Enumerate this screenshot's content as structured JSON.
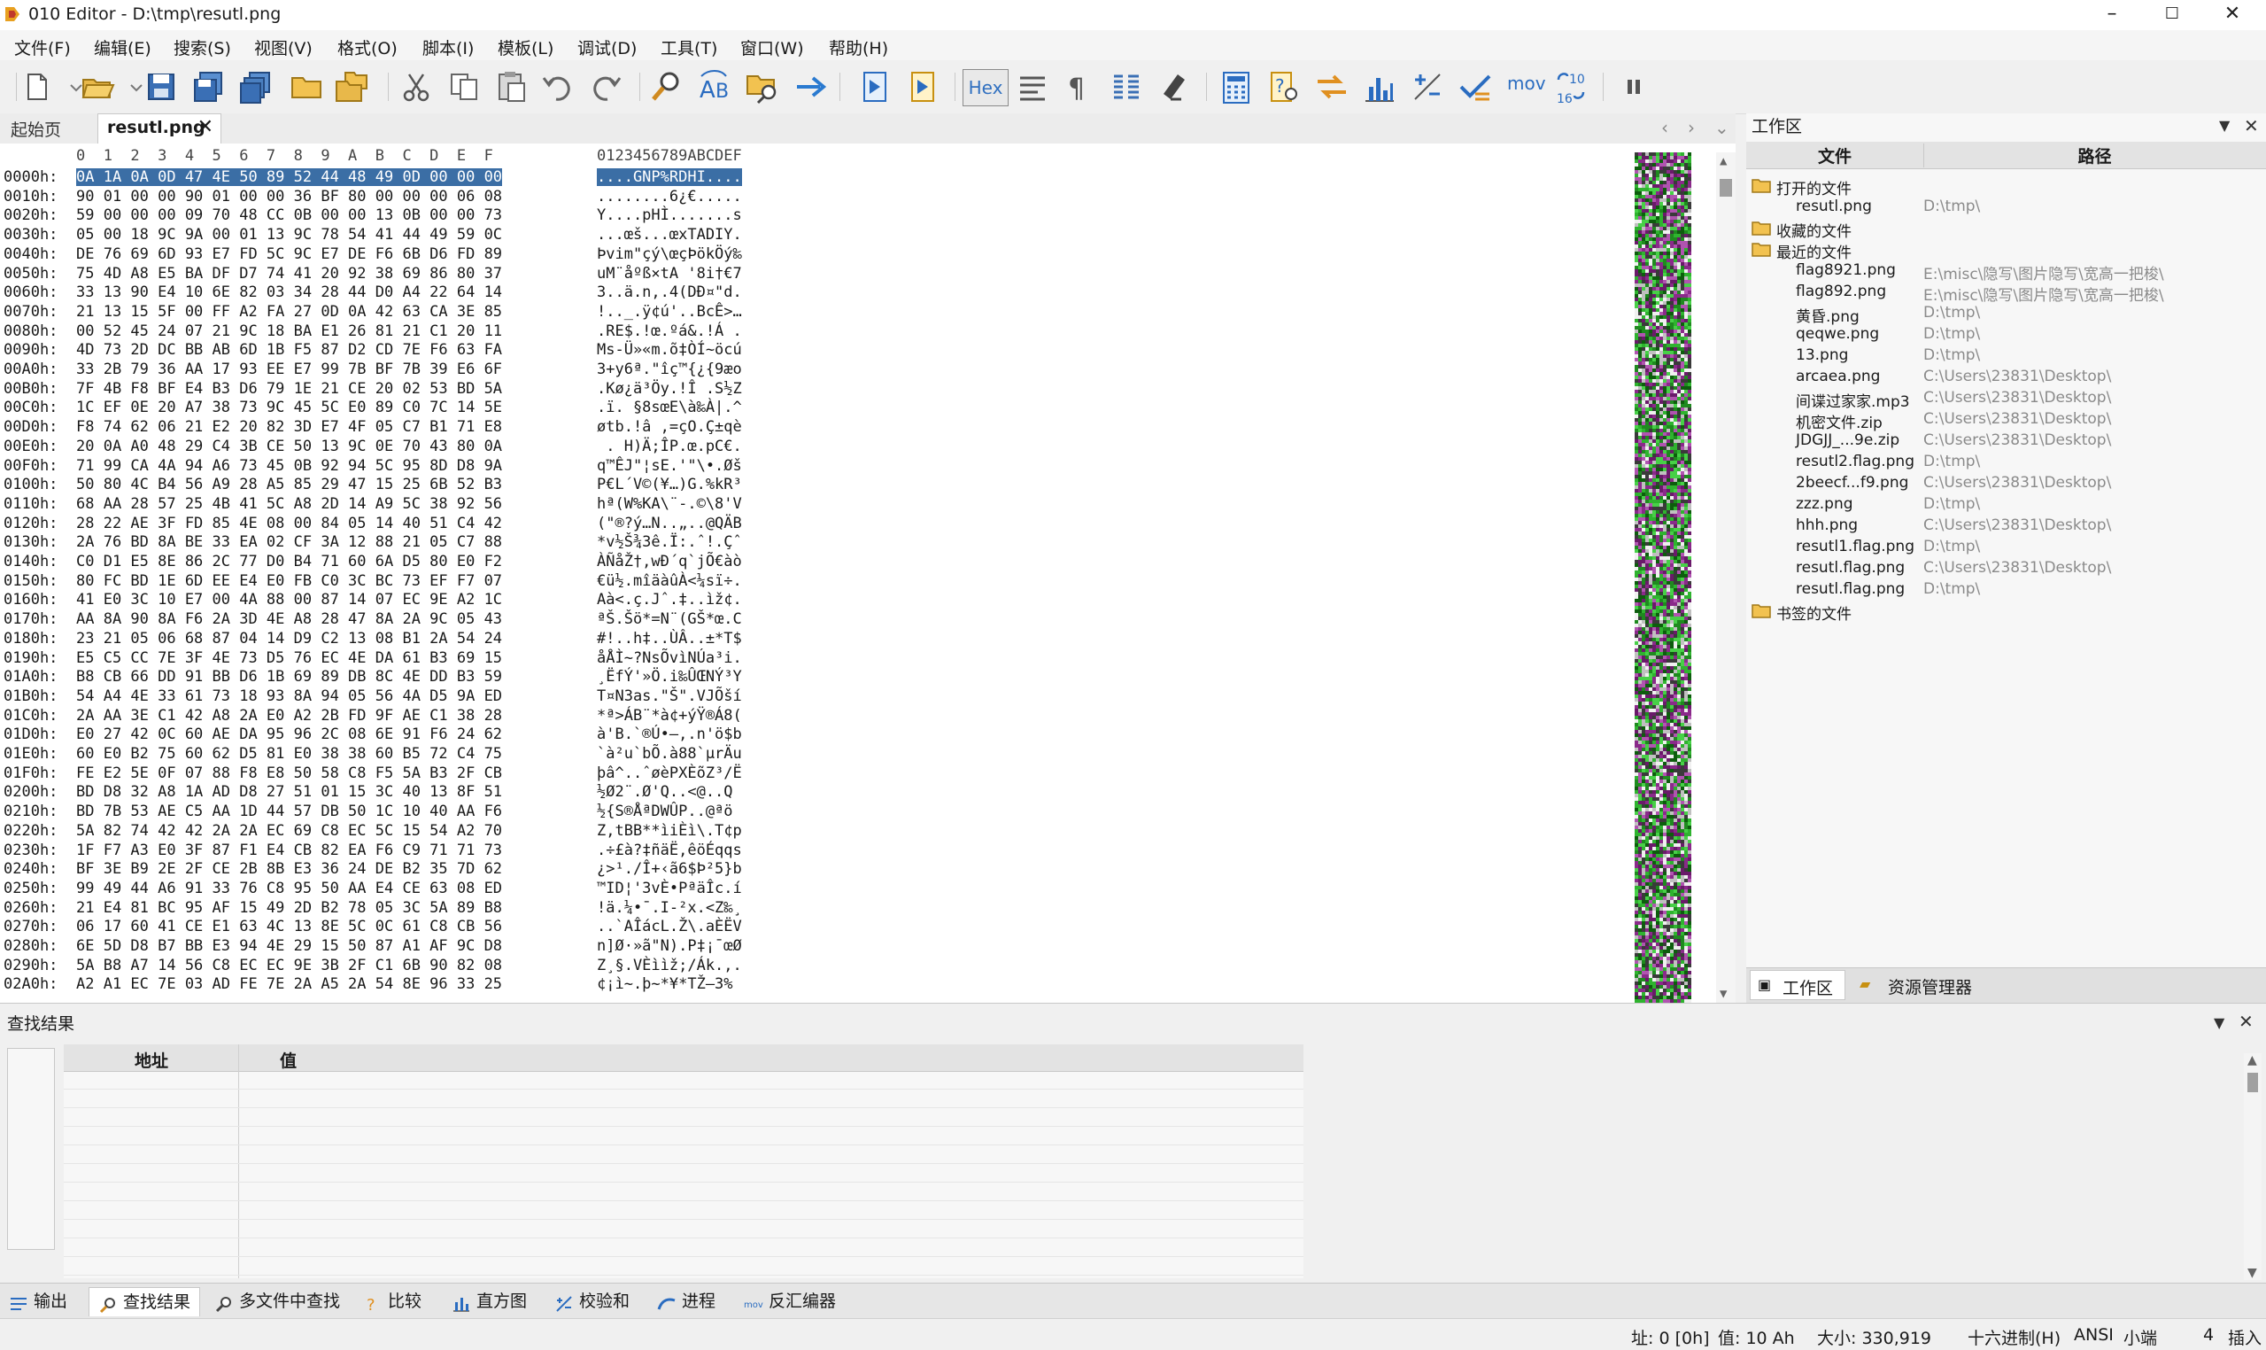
{
  "window": {
    "title": "010 Editor - D:\\tmp\\resutl.png",
    "minimize": "–",
    "maximize": "☐",
    "close": "✕"
  },
  "menu": [
    "文件(F)",
    "编辑(E)",
    "搜索(S)",
    "视图(V)",
    "格式(O)",
    "脚本(I)",
    "模板(L)",
    "调试(D)",
    "工具(T)",
    "窗口(W)",
    "帮助(H)"
  ],
  "toolbar": {
    "hex_label": "Hex",
    "mov_label": "mov",
    "base_label": "10\n16"
  },
  "tabs": {
    "home": "起始页",
    "file": "resutl.png",
    "close": "✕"
  },
  "hex": {
    "header_cols": "0  1  2  3  4  5  6  7  8  9  A  B  C  D  E  F",
    "header_ascii": "0123456789ABCDEF",
    "rows": [
      [
        "0000h:",
        "0A 1A 0A 0D 47 4E 50 89 52 44 48 49 0D 00 00 00",
        "....GNP%RDHI...."
      ],
      [
        "0010h:",
        "90 01 00 00 90 01 00 00 36 BF 80 00 00 00 06 08",
        "........6¿€....."
      ],
      [
        "0020h:",
        "59 00 00 00 09 70 48 CC 0B 00 00 13 0B 00 00 73",
        "Y....pHÌ.......s"
      ],
      [
        "0030h:",
        "05 00 18 9C 9A 00 01 13 9C 78 54 41 44 49 59 0C",
        "...œš...œxTADIY."
      ],
      [
        "0040h:",
        "DE 76 69 6D 93 E7 FD 5C 9C E7 DE F6 6B D6 FD 89",
        "Þvim\"çý\\œçÞökÖý‰"
      ],
      [
        "0050h:",
        "75 4D A8 E5 BA DF D7 74 41 20 92 38 69 86 80 37",
        "uM¨åºß×tA '8i†€7"
      ],
      [
        "0060h:",
        "33 13 90 E4 10 6E 82 03 34 28 44 D0 A4 22 64 14",
        "3..ä.n‚.4(DÐ¤\"d."
      ],
      [
        "0070h:",
        "21 13 15 5F 00 FF A2 FA 27 0D 0A 42 63 CA 3E 85",
        "!.._.ÿ¢ú'..BcÊ>…"
      ],
      [
        "0080h:",
        "00 52 45 24 07 21 9C 18 BA E1 26 81 21 C1 20 11",
        ".RE$.!œ.ºá&.!Á ."
      ],
      [
        "0090h:",
        "4D 73 2D DC BB AB 6D 1B F5 87 D2 CD 7E F6 63 FA",
        "Ms-Ü»«m.õ‡ÒÍ~öcú"
      ],
      [
        "00A0h:",
        "33 2B 79 36 AA 17 93 EE E7 99 7B BF 7B 39 E6 6F",
        "3+y6ª.\"îç™{¿{9æo"
      ],
      [
        "00B0h:",
        "7F 4B F8 BF E4 B3 D6 79 1E 21 CE 20 02 53 BD 5A",
        ".Kø¿ä³Öy.!Î .S½Z"
      ],
      [
        "00C0h:",
        "1C EF 0E 20 A7 38 73 9C 45 5C E0 89 C0 7C 14 5E",
        ".ï. §8sœE\\à‰À|.^"
      ],
      [
        "00D0h:",
        "F8 74 62 06 21 E2 20 82 3D E7 4F 05 C7 B1 71 E8",
        "øtb.!â ‚=çO.Ç±qè"
      ],
      [
        "00E0h:",
        "20 0A A0 48 29 C4 3B CE 50 13 9C 0E 70 43 80 0A",
        " . H)Ä;ÎP.œ.pC€."
      ],
      [
        "00F0h:",
        "71 99 CA 4A 94 A6 73 45 0B 92 94 5C 95 8D D8 9A",
        "q™ÊJ\"¦sE.'\"\\•.Øš"
      ],
      [
        "0100h:",
        "50 80 4C B4 56 A9 28 A5 85 29 47 15 25 6B 52 B3",
        "P€L´V©(¥…)G.%kR³"
      ],
      [
        "0110h:",
        "68 AA 28 57 25 4B 41 5C A8 2D 14 A9 5C 38 92 56",
        "hª(W%KA\\¨-.©\\8'V"
      ],
      [
        "0120h:",
        "28 22 AE 3F FD 85 4E 08 00 84 05 14 40 51 C4 42",
        "(\"®?ý…N..„..@QÄB"
      ],
      [
        "0130h:",
        "2A 76 BD 8A BE 33 EA 02 CF 3A 12 88 21 05 C7 88",
        "*v½Š¾3ê.Ï:.ˆ!.Çˆ"
      ],
      [
        "0140h:",
        "C0 D1 E5 8E 86 2C 77 D0 B4 71 60 6A D5 80 E0 F2",
        "ÀÑåŽ†,wÐ´q`jÕ€àò"
      ],
      [
        "0150h:",
        "80 FC BD 1E 6D EE E4 E0 FB C0 3C BC 73 EF F7 07",
        "€ü½.mîäàûÀ<¼sï÷."
      ],
      [
        "0160h:",
        "41 E0 3C 10 E7 00 4A 88 00 87 14 07 EC 9E A2 1C",
        "Aà<.ç.Jˆ.‡..ìž¢."
      ],
      [
        "0170h:",
        "AA 8A 90 8A F6 2A 3D 4E A8 28 47 8A 2A 9C 05 43",
        "ªŠ.Šö*=N¨(GŠ*œ.C"
      ],
      [
        "0180h:",
        "23 21 05 06 68 87 04 14 D9 C2 13 08 B1 2A 54 24",
        "#!..h‡..ÙÂ..±*T$"
      ],
      [
        "0190h:",
        "E5 C5 CC 7E 3F 4E 73 D5 76 EC 4E DA 61 B3 69 15",
        "åÅÌ~?NsÕvìNÚa³i."
      ],
      [
        "01A0h:",
        "B8 CB 66 DD 91 BB D6 1B 69 89 DB 8C 4E DD B3 59",
        "¸ËfÝ'»Ö.i‰ÛŒNÝ³Y"
      ],
      [
        "01B0h:",
        "54 A4 4E 33 61 73 18 93 8A 94 05 56 4A D5 9A ED",
        "T¤N3as.\"Š\".VJÕší"
      ],
      [
        "01C0h:",
        "2A AA 3E C1 42 A8 2A E0 A2 2B FD 9F AE C1 38 28",
        "*ª>ÁB¨*à¢+ýŸ®Á8("
      ],
      [
        "01D0h:",
        "E0 27 42 0C 60 AE DA 95 96 2C 08 6E 91 F6 24 62",
        "à'B.`®Ú•–,.n'ö$b"
      ],
      [
        "01E0h:",
        "60 E0 B2 75 60 62 D5 81 E0 38 38 60 B5 72 C4 75",
        "`à²u`bÕ.à88`µrÄu"
      ],
      [
        "01F0h:",
        "FE E2 5E 0F 07 88 F8 E8 50 58 C8 F5 5A B3 2F CB",
        "þâ^..ˆøèPXÈõZ³/Ë"
      ],
      [
        "0200h:",
        "BD D8 32 A8 1A AD D8 27 51 01 15 3C 40 13 8F 51",
        "½Ø2¨.­Ø'Q..<@..Q"
      ],
      [
        "0210h:",
        "BD 7B 53 AE C5 AA 1D 44 57 DB 50 1C 10 40 AA F6",
        "½{S®ÅªDWÛP..@ªö"
      ],
      [
        "0220h:",
        "5A 82 74 42 42 2A 2A EC 69 C8 EC 5C 15 54 A2 70",
        "Z‚tBB**ìiÈì\\.T¢p"
      ],
      [
        "0230h:",
        "1F F7 A3 E0 3F 87 F1 E4 CB 82 EA F6 C9 71 71 73",
        ".÷£à?‡ñäË‚êöÉqqs"
      ],
      [
        "0240h:",
        "BF 3E B9 2E 2F CE 2B 8B E3 36 24 DE B2 35 7D 62",
        "¿>¹./Î+‹ã6$Þ²5}b"
      ],
      [
        "0250h:",
        "99 49 44 A6 91 33 76 C8 95 50 AA E4 CE 63 08 ED",
        "™ID¦'3vÈ•PªäÎc.í"
      ],
      [
        "0260h:",
        "21 E4 81 BC 95 AF 15 49 2D B2 78 05 3C 5A 89 B8",
        "!ä.¼•¯.I-²x.<Z‰¸"
      ],
      [
        "0270h:",
        "06 17 60 41 CE E1 63 4C 13 8E 5C 0C 61 C8 CB 56",
        "..`AÎácL.Ž\\.aÈËV"
      ],
      [
        "0280h:",
        "6E 5D D8 B7 BB E3 94 4E 29 15 50 87 A1 AF 9C D8",
        "n]Ø·»ã\"N).P‡¡¯œØ"
      ],
      [
        "0290h:",
        "5A B8 A7 14 56 C8 EC EC 9E 3B 2F C1 6B 90 82 08",
        "Z¸§.VÈììž;/Ák.‚."
      ],
      [
        "02A0h:",
        "A2 A1 EC 7E 03 AD FE 7E 2A A5 2A 54 8E 96 33 25",
        "¢¡ì~.­þ~*¥*TŽ–3%"
      ]
    ]
  },
  "workspace": {
    "title": "工作区",
    "col_file": "文件",
    "col_path": "路径",
    "groups": {
      "open": "打开的文件",
      "favorites": "收藏的文件",
      "recent": "最近的文件",
      "bookmarks": "书签的文件"
    },
    "open_files": [
      {
        "name": "resutl.png",
        "path": "D:\\tmp\\"
      }
    ],
    "recent_files": [
      {
        "name": "flag8921.png",
        "path": "E:\\misc\\隐写\\图片隐写\\宽高一把梭\\"
      },
      {
        "name": "flag892.png",
        "path": "E:\\misc\\隐写\\图片隐写\\宽高一把梭\\"
      },
      {
        "name": "黄昏.png",
        "path": "D:\\tmp\\"
      },
      {
        "name": "qeqwe.png",
        "path": "D:\\tmp\\"
      },
      {
        "name": "13.png",
        "path": "D:\\tmp\\"
      },
      {
        "name": "arcaea.png",
        "path": "C:\\Users\\23831\\Desktop\\"
      },
      {
        "name": "间谍过家家.mp3",
        "path": "C:\\Users\\23831\\Desktop\\"
      },
      {
        "name": "机密文件.zip",
        "path": "C:\\Users\\23831\\Desktop\\"
      },
      {
        "name": "JDGJJ_...9e.zip",
        "path": "C:\\Users\\23831\\Desktop\\"
      },
      {
        "name": "resutl2.flag.png",
        "path": "D:\\tmp\\"
      },
      {
        "name": "2beecf...f9.png",
        "path": "C:\\Users\\23831\\Desktop\\"
      },
      {
        "name": "zzz.png",
        "path": "D:\\tmp\\"
      },
      {
        "name": "hhh.png",
        "path": "C:\\Users\\23831\\Desktop\\"
      },
      {
        "name": "resutl1.flag.png",
        "path": "D:\\tmp\\"
      },
      {
        "name": "resutl.flag.png",
        "path": "C:\\Users\\23831\\Desktop\\"
      },
      {
        "name": "resutl.flag.png",
        "path": "D:\\tmp\\"
      }
    ],
    "tab_workspace": "工作区",
    "tab_explorer": "资源管理器"
  },
  "results": {
    "title": "查找结果",
    "col_address": "地址",
    "col_value": "值"
  },
  "bottom_tabs": [
    "输出",
    "查找结果",
    "多文件中查找",
    "比较",
    "直方图",
    "校验和",
    "进程",
    "反汇编器"
  ],
  "status": {
    "address": "址: 0 [0h]",
    "value": "值: 10 Ah",
    "size": "大小: 330,919",
    "mode": "十六进制(H)",
    "encoding": "ANSI",
    "endian": "小端",
    "num": "4",
    "insert": "插入"
  }
}
